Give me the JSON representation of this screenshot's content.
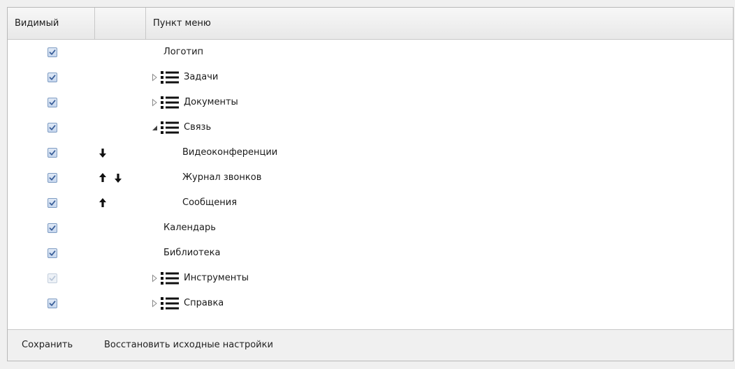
{
  "grid": {
    "header": {
      "visible": "Видимый",
      "move": "",
      "menu_item": "Пункт меню"
    },
    "rows": [
      {
        "label": "Логотип",
        "checked": true
      },
      {
        "label": "Задачи",
        "checked": true,
        "expander": "collapsed",
        "icon": "list-icon"
      },
      {
        "label": "Документы",
        "checked": true,
        "expander": "collapsed",
        "icon": "list-icon"
      },
      {
        "label": "Связь",
        "checked": true,
        "expander": "expanded",
        "icon": "list-icon"
      },
      {
        "label": "Видеоконференции",
        "checked": true,
        "child": true,
        "arrows": [
          "down"
        ]
      },
      {
        "label": "Журнал звонков",
        "checked": true,
        "child": true,
        "arrows": [
          "up",
          "down"
        ]
      },
      {
        "label": "Сообщения",
        "checked": true,
        "child": true,
        "arrows": [
          "up"
        ]
      },
      {
        "label": "Календарь",
        "checked": true
      },
      {
        "label": "Библиотека",
        "checked": true
      },
      {
        "label": "Инструменты",
        "checked": true,
        "disabled": true,
        "expander": "collapsed",
        "icon": "list-icon"
      },
      {
        "label": "Справка",
        "checked": true,
        "expander": "collapsed",
        "icon": "list-icon"
      }
    ]
  },
  "footer": {
    "save": "Сохранить",
    "restore": "Восстановить исходные настройки"
  },
  "colors": {
    "check_border": "#7d9bc2",
    "check_mark": "#3a5f99",
    "icon": "#111111"
  }
}
